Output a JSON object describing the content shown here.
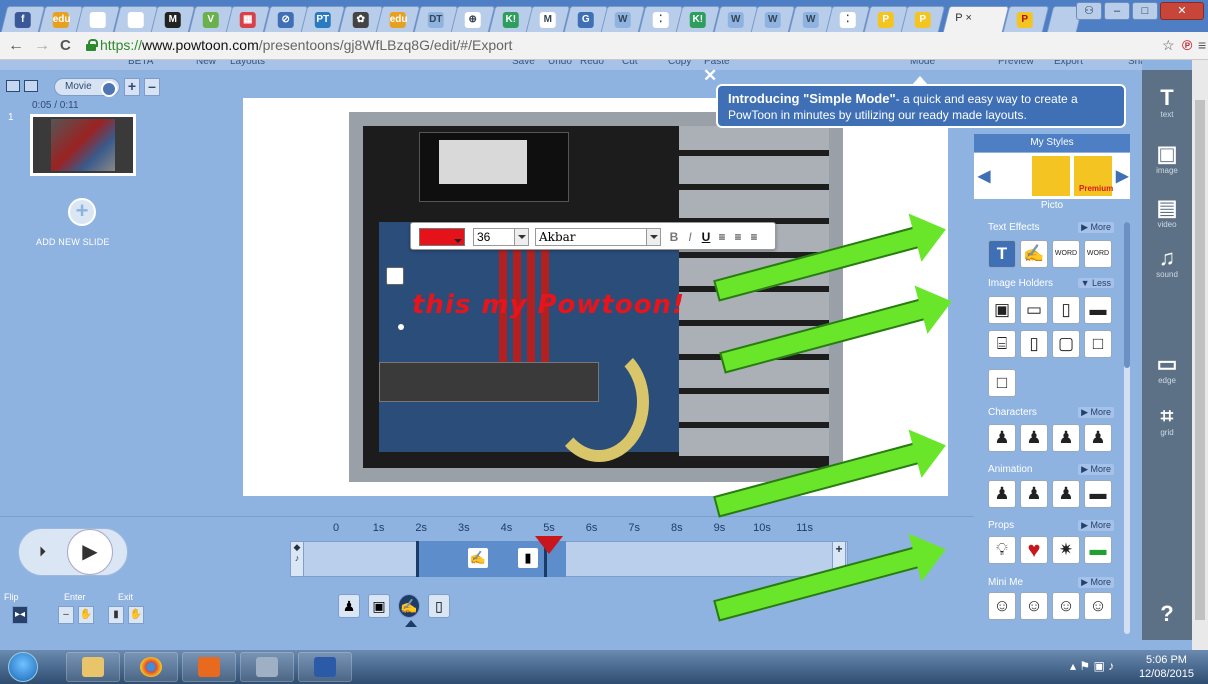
{
  "browser": {
    "active_tab_title": "P ×",
    "url_scheme": "https://",
    "url_host": "www.powtoon.com",
    "url_path": "/presentoons/gj8WfLBzq8G/edit/#/Export",
    "tab_favicons": [
      {
        "color": "#3b5998",
        "glyph": "f"
      },
      {
        "color": "#e8a020",
        "glyph": "edu"
      },
      {
        "color": "#ffffff",
        "glyph": ""
      },
      {
        "color": "#ffffff",
        "glyph": ""
      },
      {
        "color": "#222222",
        "glyph": "M"
      },
      {
        "color": "#6ab04c",
        "glyph": "V"
      },
      {
        "color": "#d9414a",
        "glyph": "▦"
      },
      {
        "color": "#3f6fb4",
        "glyph": "⊘"
      },
      {
        "color": "#2a7abf",
        "glyph": "PT"
      },
      {
        "color": "#444444",
        "glyph": "✿"
      },
      {
        "color": "#e8a020",
        "glyph": "edu"
      },
      {
        "color": "#8fb3e0",
        "glyph": "DT"
      },
      {
        "color": "#ffffff",
        "glyph": "⊕"
      },
      {
        "color": "#2e9e5e",
        "glyph": "K!"
      },
      {
        "color": "#ffffff",
        "glyph": "M"
      },
      {
        "color": "#3f6fb4",
        "glyph": "G"
      },
      {
        "color": "#8fb3e0",
        "glyph": "W"
      },
      {
        "color": "#ffffff",
        "glyph": "⁚"
      },
      {
        "color": "#2e9e5e",
        "glyph": "K!"
      },
      {
        "color": "#8fb3e0",
        "glyph": "W"
      },
      {
        "color": "#8fb3e0",
        "glyph": "W"
      },
      {
        "color": "#8fb3e0",
        "glyph": "W"
      },
      {
        "color": "#ffffff",
        "glyph": "⁚"
      },
      {
        "color": "#f4c422",
        "glyph": "P"
      },
      {
        "color": "#f4c422",
        "glyph": "P"
      }
    ]
  },
  "app_toolbar": [
    "BETA",
    "New",
    "Layouts",
    "Save",
    "Undo",
    "Redo",
    "Cut",
    "Copy",
    "Paste",
    "Mode",
    "Preview",
    "Export",
    "Share"
  ],
  "slides_panel": {
    "mode_label": "Movie",
    "time": "0:05 / 0:11",
    "slide_number": "1",
    "add_label": "ADD NEW SLIDE"
  },
  "format_toolbar": {
    "color": "#e6121a",
    "font_size": "36",
    "font_name": "Akbar",
    "bold": "B",
    "italic": "I",
    "underline": "U"
  },
  "canvas_text": "this my Powtoon!",
  "tooltip": {
    "title": "Introducing \"Simple Mode\"",
    "body": "- a quick and easy way to create a PowToon in minutes by utilizing our ready made layouts."
  },
  "library": {
    "my_styles": "My Styles",
    "premium": "Premium",
    "picto": "Picto",
    "sections": [
      {
        "title": "Text Effects",
        "toggle": "▶ More"
      },
      {
        "title": "Image Holders",
        "toggle": "▼ Less"
      },
      {
        "title": "Characters",
        "toggle": "▶ More"
      },
      {
        "title": "Animation",
        "toggle": "▶ More"
      },
      {
        "title": "Props",
        "toggle": "▶ More"
      },
      {
        "title": "Mini Me",
        "toggle": "▶ More"
      }
    ]
  },
  "rail": [
    {
      "icon": "T",
      "label": "text"
    },
    {
      "icon": "▣",
      "label": "image"
    },
    {
      "icon": "▤",
      "label": "video"
    },
    {
      "icon": "♫",
      "label": "sound"
    },
    {
      "icon": "▭",
      "label": "edge"
    },
    {
      "icon": "⌗",
      "label": "grid"
    },
    {
      "icon": "?",
      "label": ""
    }
  ],
  "timeline": {
    "ticks": [
      "0",
      "1s",
      "2s",
      "3s",
      "4s",
      "5s",
      "6s",
      "7s",
      "8s",
      "9s",
      "10s",
      "11s"
    ],
    "playhead_seconds": 5,
    "controls": {
      "flip": "Flip",
      "enter": "Enter",
      "exit": "Exit"
    }
  },
  "taskbar": {
    "time": "5:06 PM",
    "date": "12/08/2015"
  }
}
